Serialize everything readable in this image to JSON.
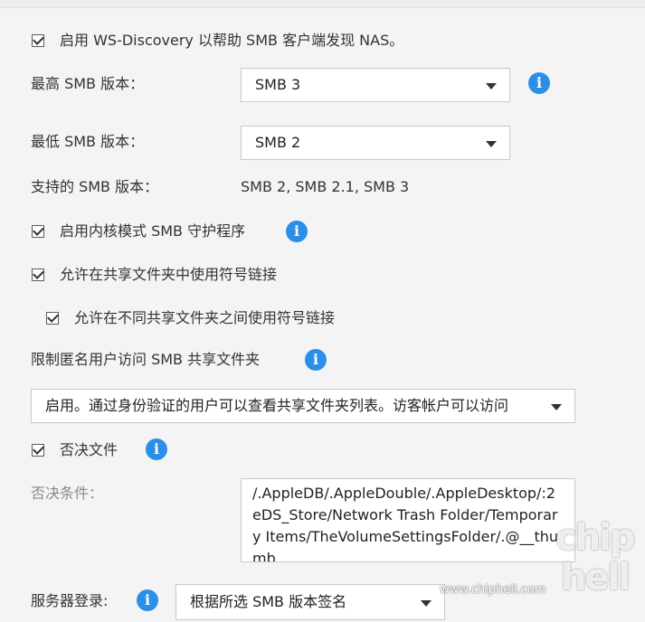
{
  "ws_discovery": {
    "label": "启用 WS-Discovery 以帮助 SMB 客户端发现 NAS。",
    "checked": true
  },
  "max_smb": {
    "label": "最高 SMB 版本：",
    "value": "SMB 3"
  },
  "min_smb": {
    "label": "最低 SMB 版本：",
    "value": "SMB 2"
  },
  "supported_smb": {
    "label": "支持的 SMB 版本：",
    "value": "SMB 2, SMB 2.1, SMB 3"
  },
  "kernel_daemon": {
    "label": "启用内核模式 SMB 守护程序",
    "checked": true
  },
  "symlinks": {
    "label": "允许在共享文件夹中使用符号链接",
    "checked": true
  },
  "cross_symlinks": {
    "label": "允许在不同共享文件夹之间使用符号链接",
    "checked": true
  },
  "anon_restrict": {
    "label": "限制匿名用户访问 SMB 共享文件夹",
    "value": "启用。通过身份验证的用户可以查看共享文件夹列表。访客帐户可以访问"
  },
  "veto_files": {
    "label": "否决文件",
    "checked": true
  },
  "veto_condition": {
    "label": "否决条件：",
    "value": "/.AppleDB/.AppleDouble/.AppleDesktop/:2eDS_Store/Network Trash Folder/Temporary Items/TheVolumeSettingsFolder/.@__thumb"
  },
  "server_signing": {
    "label": "服务器登录:",
    "value": "根据所选 SMB 版本签名"
  },
  "watermark": {
    "url": "www.chiphell.com",
    "logo_top": "chip",
    "logo_bottom": "hell"
  },
  "colors": {
    "info": "#2b8fe8",
    "background": "#f4f4f4"
  }
}
